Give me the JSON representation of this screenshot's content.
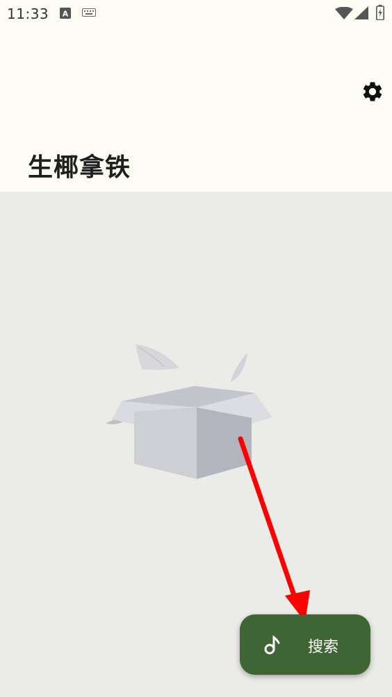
{
  "status_bar": {
    "time": "11:33",
    "icons": [
      "text-a-icon",
      "keyboard-icon",
      "wifi-icon",
      "signal-icon",
      "battery-charging-icon"
    ]
  },
  "header": {
    "title": "生椰拿铁",
    "settings_icon": "gear-icon"
  },
  "main": {
    "empty_state_illustration": "empty-box-icon"
  },
  "fab": {
    "label": "搜索",
    "icon": "music-note-icon"
  },
  "annotation": {
    "arrow_color": "#FF0000"
  },
  "colors": {
    "header_background": "#FCFCF5",
    "body_background": "#EBEBE8",
    "fab_background": "#3F6535",
    "fab_text": "#FFFFFF"
  }
}
